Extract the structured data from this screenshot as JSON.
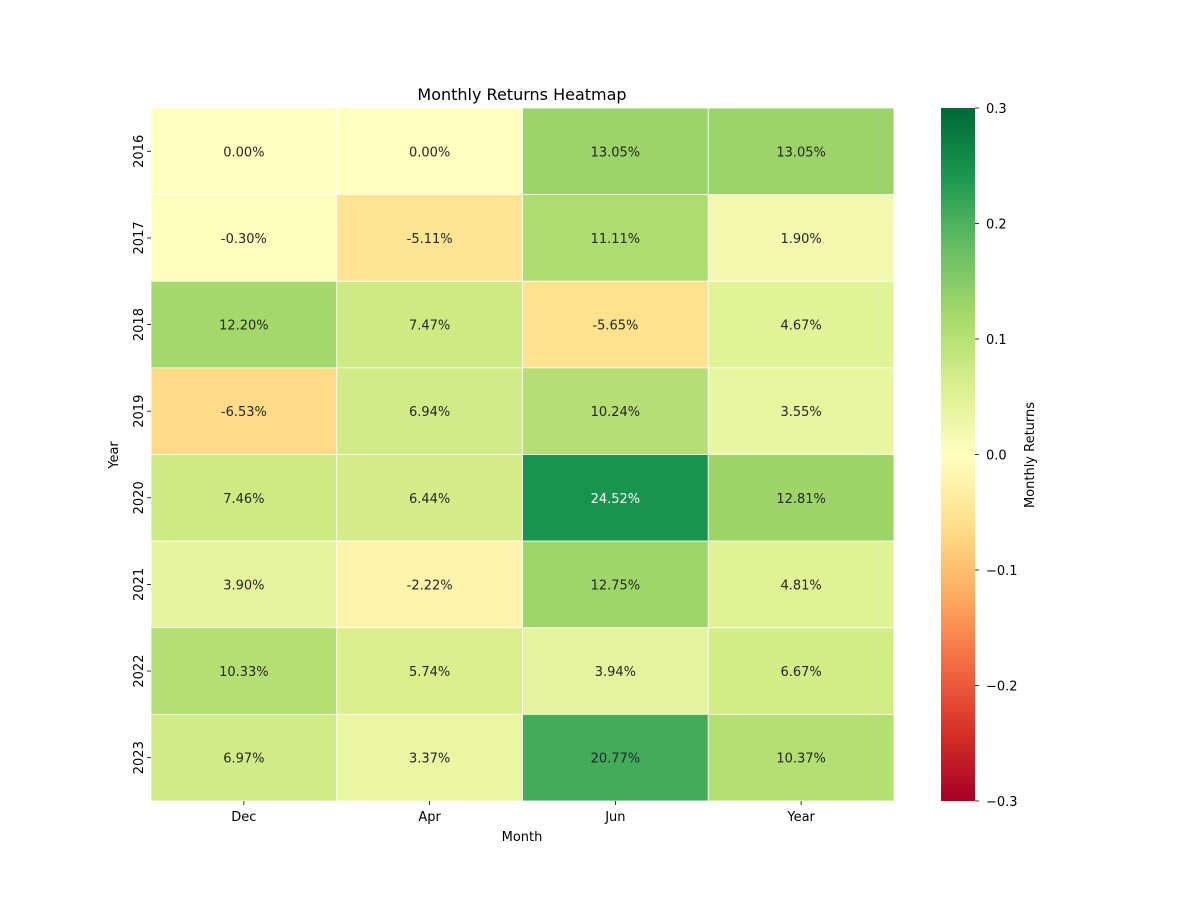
{
  "chart_data": {
    "type": "heatmap",
    "title": "Monthly Returns Heatmap",
    "xlabel": "Month",
    "ylabel": "Year",
    "x_categories": [
      "Dec",
      "Apr",
      "Jun",
      "Year"
    ],
    "y_categories": [
      "2016",
      "2017",
      "2018",
      "2019",
      "2020",
      "2021",
      "2022",
      "2023"
    ],
    "values": [
      [
        0.0,
        0.0,
        0.1305,
        0.1305
      ],
      [
        -0.003,
        -0.0511,
        0.1111,
        0.019
      ],
      [
        0.122,
        0.0747,
        -0.0565,
        0.0467
      ],
      [
        -0.0653,
        0.0694,
        0.1024,
        0.0355
      ],
      [
        0.0746,
        0.0644,
        0.2452,
        0.1281
      ],
      [
        0.039,
        -0.0222,
        0.1275,
        0.0481
      ],
      [
        0.1033,
        0.0574,
        0.0394,
        0.0667
      ],
      [
        0.0697,
        0.0337,
        0.2077,
        0.1037
      ]
    ],
    "annotations": [
      [
        "0.00%",
        "0.00%",
        "13.05%",
        "13.05%"
      ],
      [
        "-0.30%",
        "-5.11%",
        "11.11%",
        "1.90%"
      ],
      [
        "12.20%",
        "7.47%",
        "-5.65%",
        "4.67%"
      ],
      [
        "-6.53%",
        "6.94%",
        "10.24%",
        "3.55%"
      ],
      [
        "7.46%",
        "6.44%",
        "24.52%",
        "12.81%"
      ],
      [
        "3.90%",
        "-2.22%",
        "12.75%",
        "4.81%"
      ],
      [
        "10.33%",
        "5.74%",
        "3.94%",
        "6.67%"
      ],
      [
        "6.97%",
        "3.37%",
        "20.77%",
        "10.37%"
      ]
    ],
    "colormap": "RdYlGn",
    "vmin": -0.3,
    "vmax": 0.3,
    "colorbar": {
      "label": "Monthly Returns",
      "ticks": [
        0.3,
        0.2,
        0.1,
        0.0,
        -0.1,
        -0.2,
        -0.3
      ],
      "tick_labels": [
        "0.3",
        "0.2",
        "0.1",
        "0.0",
        "−0.1",
        "−0.2",
        "−0.3"
      ]
    }
  }
}
